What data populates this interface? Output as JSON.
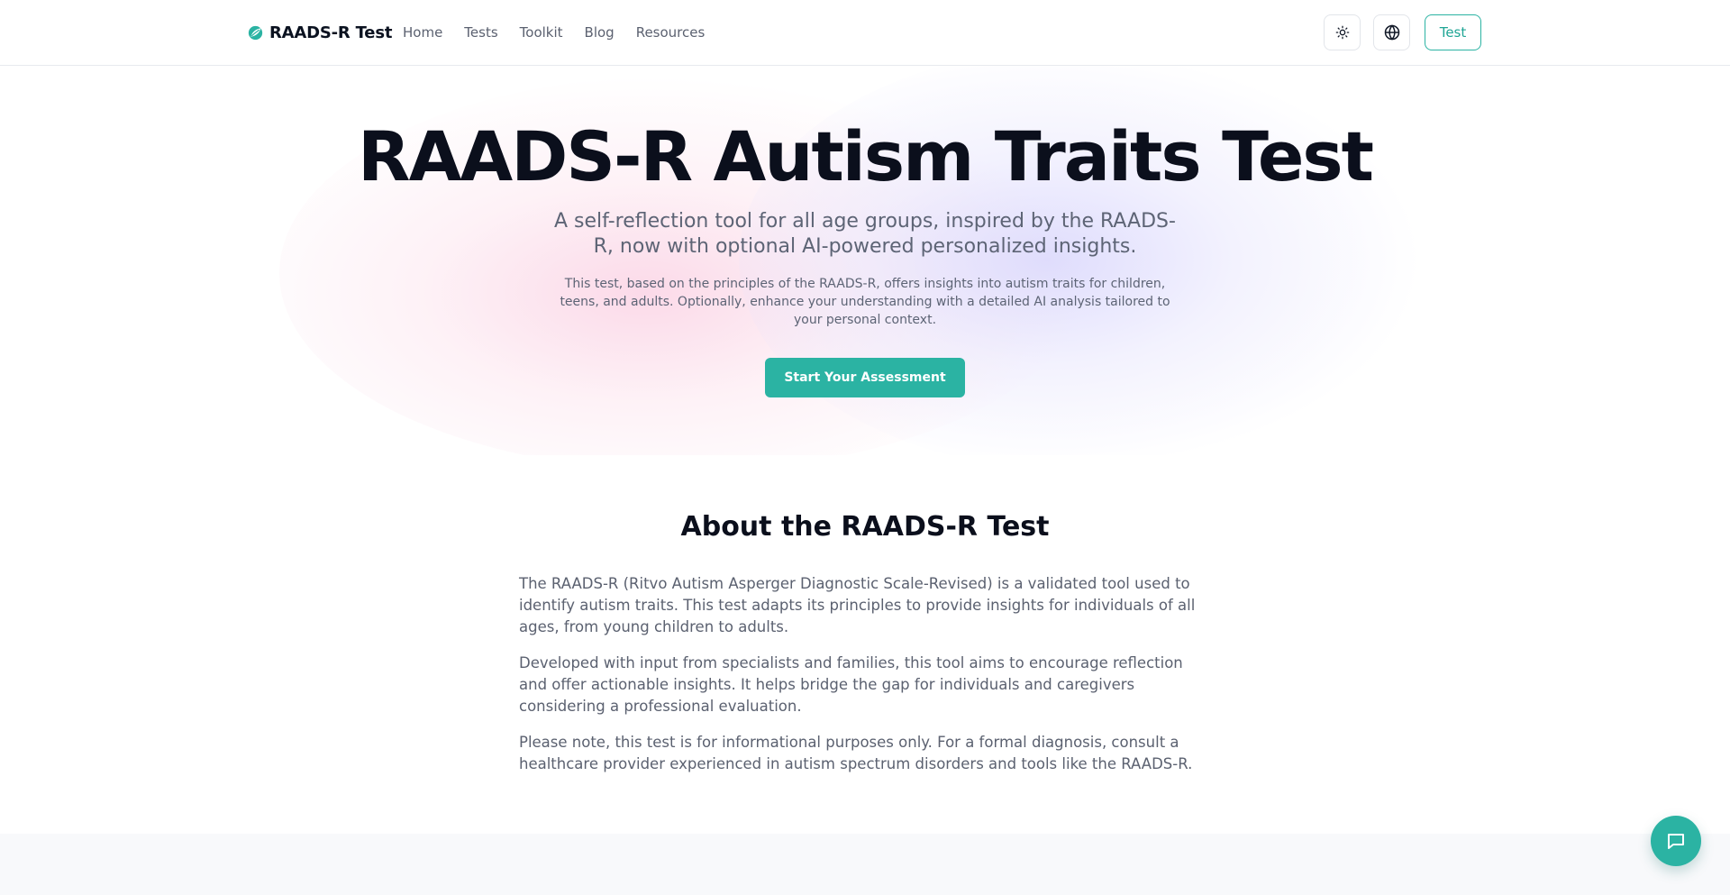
{
  "header": {
    "brand": "RAADS-R Test",
    "nav": [
      "Home",
      "Tests",
      "Toolkit",
      "Blog",
      "Resources"
    ],
    "theme_icon": "sun-icon",
    "language_icon": "globe-icon",
    "test_button": "Test"
  },
  "hero": {
    "title": "RAADS-R Autism Traits Test",
    "subtitle": "A self-reflection tool for all age groups, inspired by the RAADS-R, now with optional AI-powered personalized insights.",
    "description": "This test, based on the principles of the RAADS-R, offers insights into autism traits for children, teens, and adults. Optionally, enhance your understanding with a detailed AI analysis tailored to your personal context.",
    "cta": "Start Your Assessment"
  },
  "about": {
    "title": "About the RAADS-R Test",
    "paragraphs": [
      "The RAADS-R (Ritvo Autism Asperger Diagnostic Scale-Revised) is a validated tool used to identify autism traits. This test adapts its principles to provide insights for individuals of all ages, from young children to adults.",
      "Developed with input from specialists and families, this tool aims to encourage reflection and offer actionable insights. It helps bridge the gap for individuals and caregivers considering a professional evaluation.",
      "Please note, this test is for informational purposes only. For a formal diagnosis, consult a healthcare provider experienced in autism spectrum disorders and tools like the RAADS-R."
    ]
  },
  "chat": {
    "icon": "chat-bubble-icon"
  },
  "colors": {
    "accent": "#2bb3a3",
    "heading": "#0b0f1c",
    "body_text": "#5b6170"
  }
}
